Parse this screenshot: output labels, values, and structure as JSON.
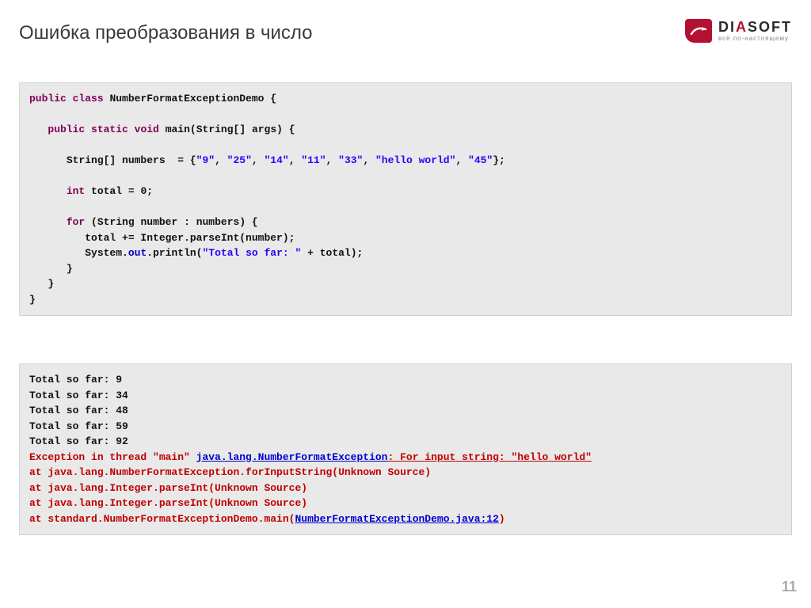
{
  "title": "Ошибка преобразования в число",
  "logo": {
    "word_before": "DI",
    "word_accent": "A",
    "word_after": "SOFT",
    "tagline": "всё по-настоящему"
  },
  "code": {
    "kw_public": "public",
    "kw_class": "class",
    "class_name": "NumberFormatExceptionDemo",
    "kw_static": "static",
    "kw_void": "void",
    "main": "main",
    "main_args_type": "String",
    "main_args_name": "args",
    "decl_numbers_type": "String",
    "decl_numbers_name": "numbers",
    "arr_vals": [
      "\"9\"",
      "\"25\"",
      "\"14\"",
      "\"11\"",
      "\"33\"",
      "\"hello world\"",
      "\"45\""
    ],
    "kw_int": "int",
    "total_name": "total",
    "zero": "0",
    "kw_for": "for",
    "loop_type": "String",
    "loop_var": "number",
    "loop_iter": "numbers",
    "assign_line": "total += Integer.parseInt(number);",
    "sys": "System",
    "out_field": "out",
    "println": "println",
    "msg": "\"Total so far: \"",
    "plus_total": " + total);"
  },
  "output": {
    "lines": [
      "Total so far: 9",
      "Total so far: 34",
      "Total so far: 48",
      "Total so far: 59",
      "Total so far: 92"
    ],
    "err_prefix": "Exception in thread \"main\" ",
    "err_link1": "java.lang.NumberFormatException",
    "err_mid": ": For input string: \"hello world\"",
    "trace": [
      "at java.lang.NumberFormatException.forInputString(Unknown Source)",
      "at java.lang.Integer.parseInt(Unknown Source)",
      "at java.lang.Integer.parseInt(Unknown Source)"
    ],
    "trace_last_prefix": "at standard.NumberFormatExceptionDemo.main(",
    "trace_last_link": "NumberFormatExceptionDemo.java:12",
    "trace_last_suffix": ")"
  },
  "page_number": "11"
}
